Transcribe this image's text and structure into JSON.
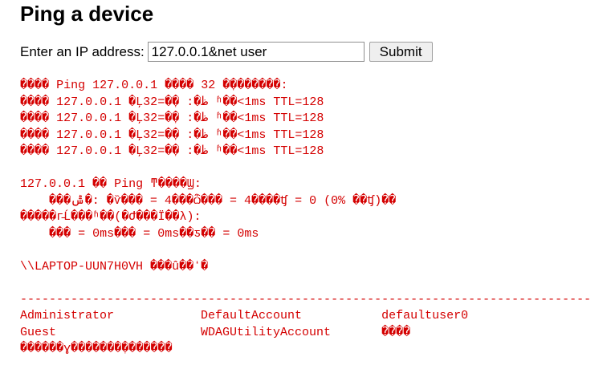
{
  "header": {
    "title": "Ping a device"
  },
  "form": {
    "label": "Enter an IP address:",
    "input_value": "127.0.0.1&net user",
    "submit_label": "Submit"
  },
  "output": {
    "text": "���� Ping 127.0.0.1 ���� 32 �ֽ�������:\n���� 127.0.0.1 �Ļظ�: �ֽ�=32 ʱ��<1ms TTL=128\n���� 127.0.0.1 �Ļظ�: �ֽ�=32 ʱ��<1ms TTL=128\n���� 127.0.0.1 �Ļظ�: �ֽ�=32 ʱ��<1ms TTL=128\n���� 127.0.0.1 �Ļظ�: �ֽ�=32 ʱ��<1ms TTL=128\n\n127.0.0.1 �� Ping ͳ����Ϣ:\n    ���ݰ�: �ѷ��� = 4���ѽ��� = 4����ʧ = 0 (0% ��ʧ)��\n�����г̵Ĺ���ʱ��(�Ժ���Ϊ��λ):\n    ��� = 0ms��� = 0ms��ƽ�� = 0ms\n\n\\\\LAPTOP-UUN7H0VH ���û��ʻ�\n\n-------------------------------------------------------------------------------\nAdministrator            DefaultAccount           defaultuser0\nGuest                    WDAGUtilityAccount       ����\n������ɣ�������ִ�������"
  }
}
